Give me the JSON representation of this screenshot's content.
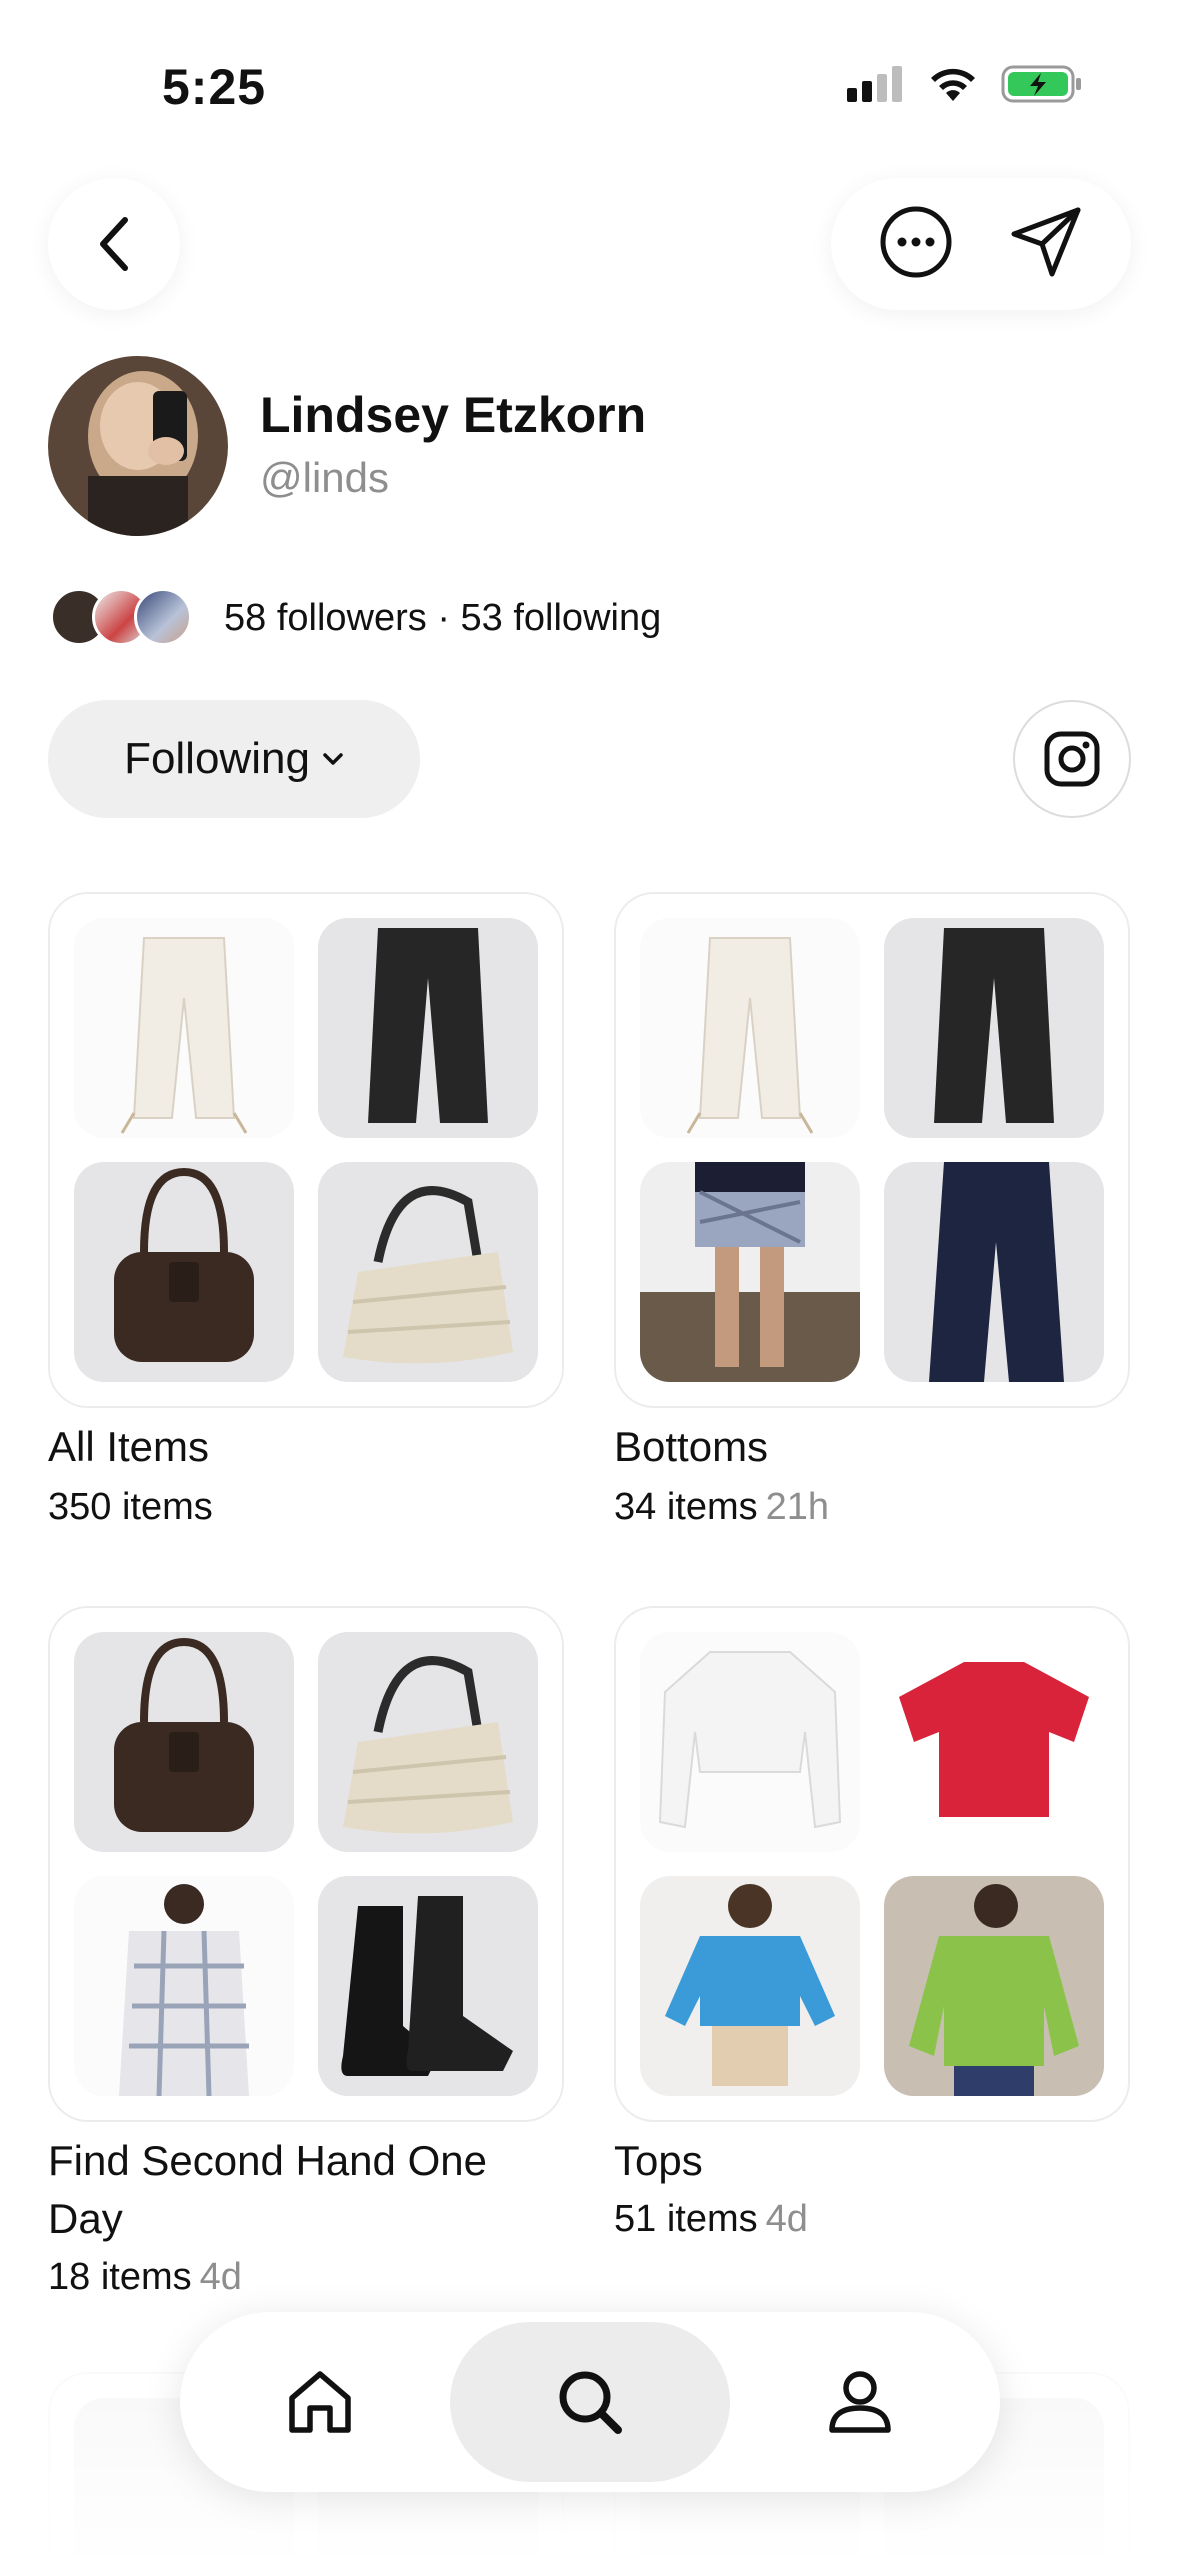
{
  "status": {
    "time": "5:25"
  },
  "profile": {
    "name": "Lindsey Etzkorn",
    "handle": "@linds"
  },
  "social": {
    "text": "58 followers · 53 following"
  },
  "follow_button": {
    "label": "Following"
  },
  "collections": [
    {
      "title": "All Items",
      "count": "350 items",
      "ago": ""
    },
    {
      "title": "Bottoms",
      "count": "34 items",
      "ago": "21h"
    },
    {
      "title": "Find Second Hand One Day",
      "count": "18 items",
      "ago": "4d"
    },
    {
      "title": "Tops",
      "count": "51 items",
      "ago": "4d"
    }
  ],
  "icons": {
    "back": "chevron-left-icon",
    "more": "more-horizontal-icon",
    "share": "send-icon",
    "instagram": "instagram-icon",
    "home": "home-icon",
    "search": "search-icon",
    "profile": "person-icon"
  },
  "colors": {
    "battery": "#34c759",
    "tab_active": "#ececec",
    "muted": "#8e8e8e"
  }
}
